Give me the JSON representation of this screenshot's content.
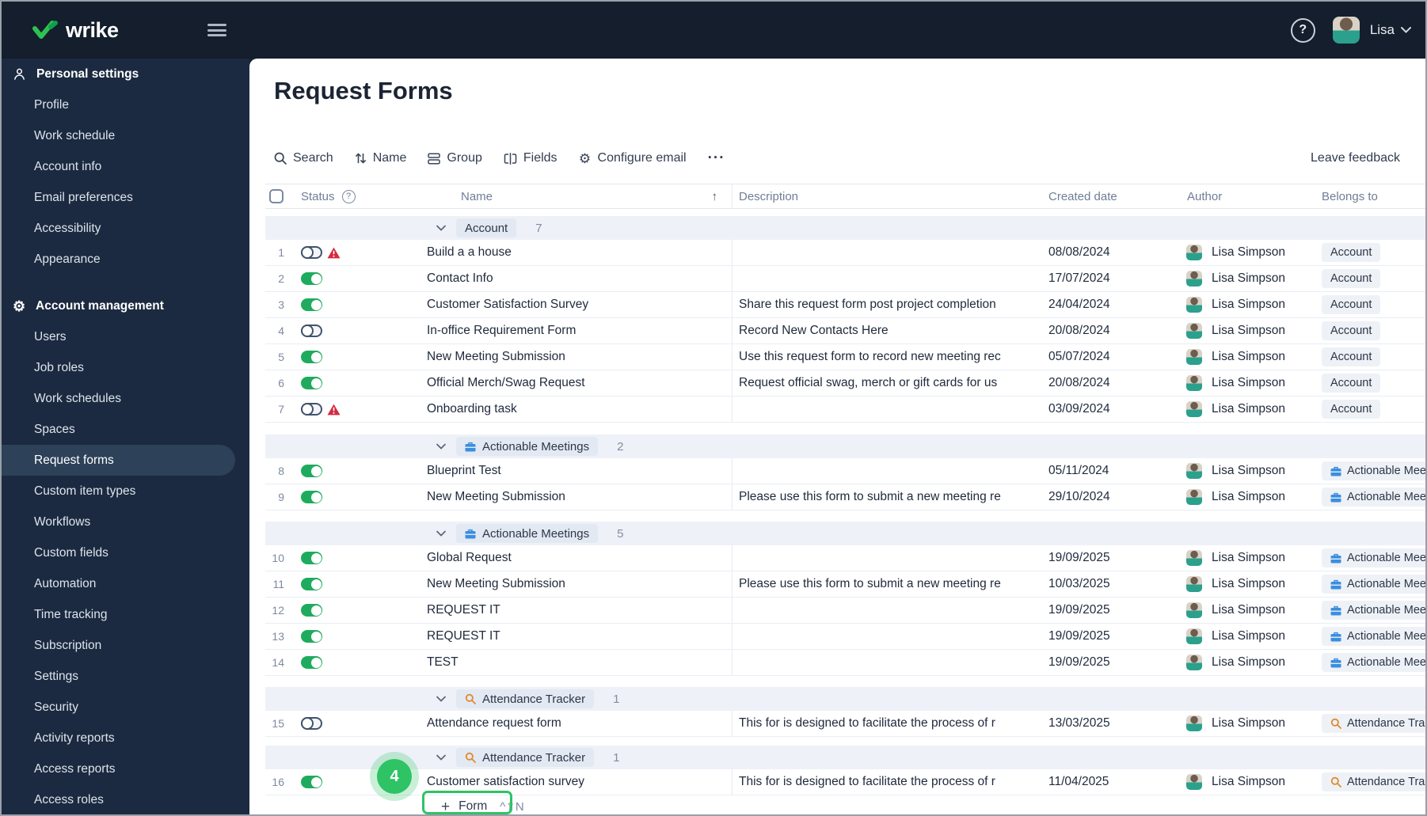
{
  "topbar": {
    "logo_text": "wrike",
    "user_name": "Lisa"
  },
  "sidebar": {
    "sections": [
      {
        "label": "Personal settings",
        "icon": "person-icon",
        "items": [
          "Profile",
          "Work schedule",
          "Account info",
          "Email preferences",
          "Accessibility",
          "Appearance"
        ]
      },
      {
        "label": "Account management",
        "icon": "gear-icon",
        "selected": "Request forms",
        "items": [
          "Users",
          "Job roles",
          "Work schedules",
          "Spaces",
          "Request forms",
          "Custom item types",
          "Workflows",
          "Custom fields",
          "Automation",
          "Time tracking",
          "Subscription",
          "Settings",
          "Security",
          "Activity reports",
          "Access reports",
          "Access roles"
        ]
      }
    ]
  },
  "main": {
    "title": "Request Forms",
    "toolbar": {
      "search": "Search",
      "sort": "Name",
      "group": "Group",
      "fields": "Fields",
      "configure_email": "Configure email",
      "more": "···",
      "leave_feedback": "Leave feedback"
    },
    "table": {
      "headers": {
        "status": "Status",
        "name": "Name",
        "description": "Description",
        "created": "Created date",
        "author": "Author",
        "belongs": "Belongs to",
        "sort_indicator": "↑"
      },
      "groups": [
        {
          "label": "Account",
          "icon": null,
          "count": "7",
          "rows": [
            {
              "num": "1",
              "enabled": false,
              "warning": true,
              "name": "Build a a house",
              "description": "",
              "created": "08/08/2024",
              "author": "Lisa Simpson",
              "belongs": "Account",
              "belongs_icon": null
            },
            {
              "num": "2",
              "enabled": true,
              "warning": false,
              "name": "Contact Info",
              "description": "",
              "created": "17/07/2024",
              "author": "Lisa Simpson",
              "belongs": "Account",
              "belongs_icon": null
            },
            {
              "num": "3",
              "enabled": true,
              "warning": false,
              "name": "Customer Satisfaction Survey",
              "description": "Share this request form post project completion",
              "created": "24/04/2024",
              "author": "Lisa Simpson",
              "belongs": "Account",
              "belongs_icon": null
            },
            {
              "num": "4",
              "enabled": false,
              "warning": false,
              "name": "In-office Requirement Form",
              "description": "Record New Contacts Here",
              "created": "20/08/2024",
              "author": "Lisa Simpson",
              "belongs": "Account",
              "belongs_icon": null
            },
            {
              "num": "5",
              "enabled": true,
              "warning": false,
              "name": "New Meeting Submission",
              "description": "Use this request form to record new meeting rec",
              "created": "05/07/2024",
              "author": "Lisa Simpson",
              "belongs": "Account",
              "belongs_icon": null
            },
            {
              "num": "6",
              "enabled": true,
              "warning": false,
              "name": "Official Merch/Swag Request",
              "description": "Request official swag, merch or gift cards for us",
              "created": "20/08/2024",
              "author": "Lisa Simpson",
              "belongs": "Account",
              "belongs_icon": null
            },
            {
              "num": "7",
              "enabled": false,
              "warning": true,
              "name": "Onboarding task",
              "description": "",
              "created": "03/09/2024",
              "author": "Lisa Simpson",
              "belongs": "Account",
              "belongs_icon": null
            }
          ]
        },
        {
          "label": "Actionable Meetings",
          "icon": "briefcase-icon",
          "count": "2",
          "rows": [
            {
              "num": "8",
              "enabled": true,
              "warning": false,
              "name": "Blueprint Test",
              "description": "",
              "created": "05/11/2024",
              "author": "Lisa Simpson",
              "belongs": "Actionable Meetings",
              "belongs_icon": "briefcase-icon"
            },
            {
              "num": "9",
              "enabled": true,
              "warning": false,
              "name": "New Meeting Submission",
              "description": "Please use this form to submit a new meeting re",
              "created": "29/10/2024",
              "author": "Lisa Simpson",
              "belongs": "Actionable Meetings",
              "belongs_icon": "briefcase-icon"
            }
          ]
        },
        {
          "label": "Actionable Meetings",
          "icon": "briefcase-icon",
          "count": "5",
          "rows": [
            {
              "num": "10",
              "enabled": true,
              "warning": false,
              "name": "Global Request",
              "description": "",
              "created": "19/09/2025",
              "author": "Lisa Simpson",
              "belongs": "Actionable Meetings",
              "belongs_icon": "briefcase-icon"
            },
            {
              "num": "11",
              "enabled": true,
              "warning": false,
              "name": "New Meeting Submission",
              "description": "Please use this form to submit a new meeting re",
              "created": "10/03/2025",
              "author": "Lisa Simpson",
              "belongs": "Actionable Meetings",
              "belongs_icon": "briefcase-icon"
            },
            {
              "num": "12",
              "enabled": true,
              "warning": false,
              "name": "REQUEST IT",
              "description": "",
              "created": "19/09/2025",
              "author": "Lisa Simpson",
              "belongs": "Actionable Meetings",
              "belongs_icon": "briefcase-icon"
            },
            {
              "num": "13",
              "enabled": true,
              "warning": false,
              "name": "REQUEST IT",
              "description": "",
              "created": "19/09/2025",
              "author": "Lisa Simpson",
              "belongs": "Actionable Meetings",
              "belongs_icon": "briefcase-icon"
            },
            {
              "num": "14",
              "enabled": true,
              "warning": false,
              "name": "TEST",
              "description": "",
              "created": "19/09/2025",
              "author": "Lisa Simpson",
              "belongs": "Actionable Meetings",
              "belongs_icon": "briefcase-icon"
            }
          ]
        },
        {
          "label": "Attendance Tracker",
          "icon": "magnifier-icon",
          "count": "1",
          "rows": [
            {
              "num": "15",
              "enabled": false,
              "warning": false,
              "name": "Attendance request form",
              "description": "This for is designed to facilitate the process of r",
              "created": "13/03/2025",
              "author": "Lisa Simpson",
              "belongs": "Attendance Tracker",
              "belongs_icon": "magnifier-icon"
            }
          ]
        },
        {
          "label": "Attendance Tracker",
          "icon": "magnifier-icon",
          "count": "1",
          "rows": [
            {
              "num": "16",
              "enabled": true,
              "warning": false,
              "name": "Customer satisfaction survey",
              "description": "This for is designed to facilitate the process of r",
              "created": "11/04/2025",
              "author": "Lisa Simpson",
              "belongs": "Attendance Tracker",
              "belongs_icon": "magnifier-icon"
            }
          ]
        }
      ]
    },
    "footer": {
      "add_form_label": "Form",
      "shortcut": "^⇧N"
    },
    "annotation": {
      "badge": "4"
    }
  },
  "colors": {
    "annotation_green": "#2ec365",
    "toggle_on_green": "#1fab5e",
    "warning_red": "#d52a3f",
    "briefcase_blue": "#3b8ede",
    "magnifier_orange": "#e08a2f",
    "topbar_bg": "#141e2c",
    "sidebar_bg": "#1b2a40",
    "sidebar_selected_bg": "#2d4158"
  }
}
